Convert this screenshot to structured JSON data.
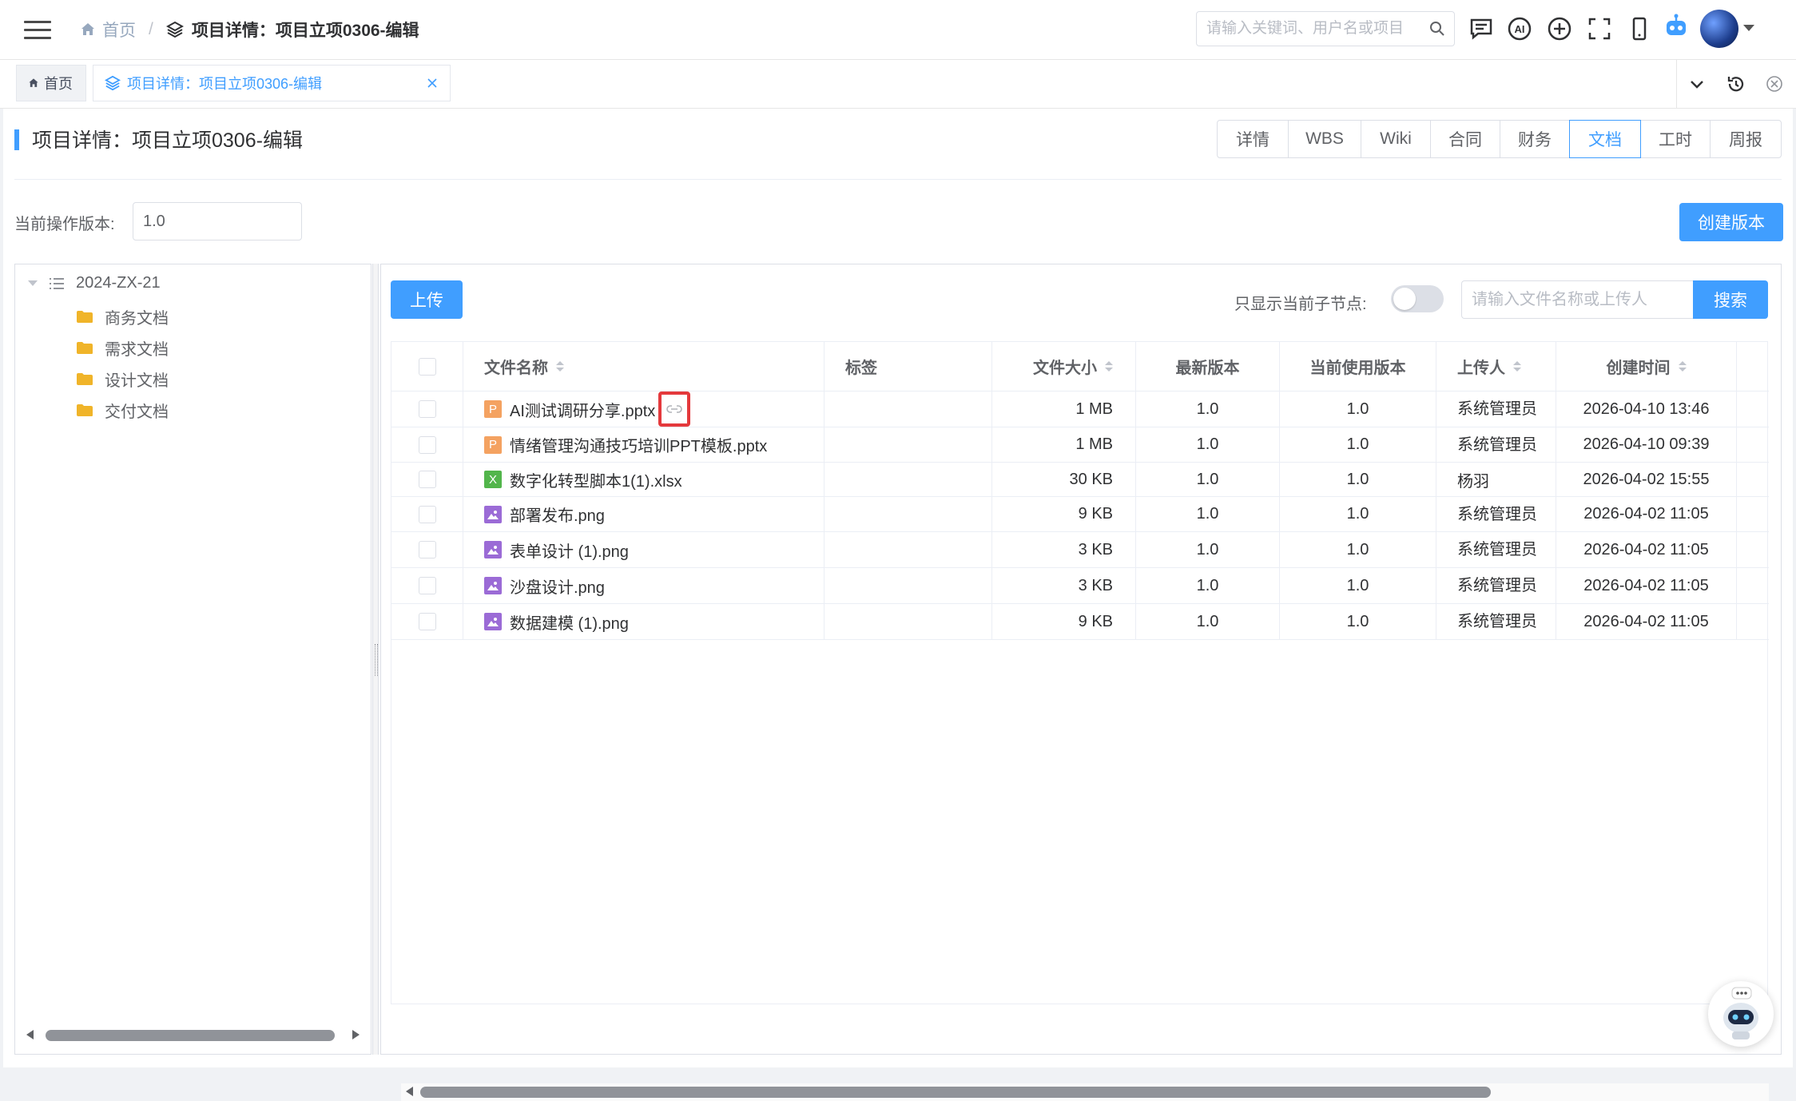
{
  "header": {
    "breadcrumb": {
      "home": "首页",
      "current": "项目详情：项目立项0306-编辑"
    },
    "search_placeholder": "请输入关键词、用户名或项目"
  },
  "tags": {
    "home": "首页",
    "active": "项目详情：项目立项0306-编辑"
  },
  "page": {
    "title": "项目详情：项目立项0306-编辑",
    "tabs": [
      "详情",
      "WBS",
      "Wiki",
      "合同",
      "财务",
      "文档",
      "工时",
      "周报"
    ],
    "active_tab": "文档",
    "version_label": "当前操作版本:",
    "version_value": "1.0",
    "create_version_button": "创建版本"
  },
  "tree": {
    "root": "2024-ZX-21",
    "children": [
      "商务文档",
      "需求文档",
      "设计文档",
      "交付文档"
    ]
  },
  "toolbar": {
    "upload": "上传",
    "switch_label": "只显示当前子节点:",
    "switch_on": false,
    "search_placeholder": "请输入文件名称或上传人",
    "search_button": "搜索"
  },
  "table": {
    "columns": [
      "文件名称",
      "标签",
      "文件大小",
      "最新版本",
      "当前使用版本",
      "上传人",
      "创建时间"
    ],
    "rows": [
      {
        "type": "P",
        "name": "AI测试调研分享.pptx",
        "tag": "",
        "size": "1 MB",
        "latest": "1.0",
        "current": "1.0",
        "uploader": "系统管理员",
        "created": "2026-04-10 13:46"
      },
      {
        "type": "P",
        "name": "情绪管理沟通技巧培训PPT模板.pptx",
        "tag": "",
        "size": "1 MB",
        "latest": "1.0",
        "current": "1.0",
        "uploader": "系统管理员",
        "created": "2026-04-10 09:39"
      },
      {
        "type": "X",
        "name": "数字化转型脚本1(1).xlsx",
        "tag": "",
        "size": "30 KB",
        "latest": "1.0",
        "current": "1.0",
        "uploader": "杨羽",
        "created": "2026-04-02 15:55"
      },
      {
        "type": "img",
        "name": "部署发布.png",
        "tag": "",
        "size": "9 KB",
        "latest": "1.0",
        "current": "1.0",
        "uploader": "系统管理员",
        "created": "2026-04-02 11:05"
      },
      {
        "type": "img",
        "name": "表单设计 (1).png",
        "tag": "",
        "size": "3 KB",
        "latest": "1.0",
        "current": "1.0",
        "uploader": "系统管理员",
        "created": "2026-04-02 11:05"
      },
      {
        "type": "img",
        "name": "沙盘设计.png",
        "tag": "",
        "size": "3 KB",
        "latest": "1.0",
        "current": "1.0",
        "uploader": "系统管理员",
        "created": "2026-04-02 11:05"
      },
      {
        "type": "img",
        "name": "数据建模 (1).png",
        "tag": "",
        "size": "9 KB",
        "latest": "1.0",
        "current": "1.0",
        "uploader": "系统管理员",
        "created": "2026-04-02 11:05"
      }
    ]
  },
  "colors": {
    "primary": "#409eff",
    "highlight": "#e4393c"
  }
}
